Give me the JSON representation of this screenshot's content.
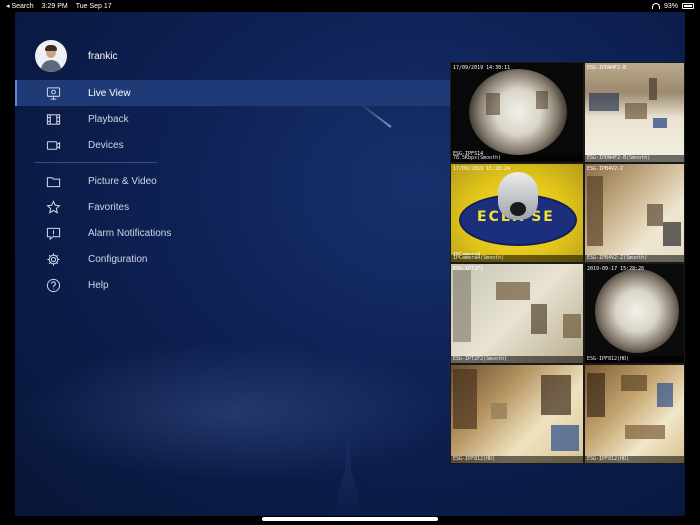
{
  "status_bar": {
    "back_label": "◂ Search",
    "time": "3:29 PM",
    "date": "Tue Sep 17",
    "battery": "93%"
  },
  "profile": {
    "username": "frankic"
  },
  "menu": {
    "items": [
      {
        "label": "Live View",
        "icon": "monitor-icon"
      },
      {
        "label": "Playback",
        "icon": "film-icon"
      },
      {
        "label": "Devices",
        "icon": "camera-icon"
      }
    ],
    "secondary_items": [
      {
        "label": "Picture & Video",
        "icon": "folder-icon"
      },
      {
        "label": "Favorites",
        "icon": "star-icon"
      },
      {
        "label": "Alarm Notifications",
        "icon": "alert-icon"
      },
      {
        "label": "Configuration",
        "icon": "gear-icon"
      },
      {
        "label": "Help",
        "icon": "help-icon"
      }
    ]
  },
  "cameras": [
    {
      "stamp": "17/09/2019 14:30:11",
      "label": "78.5Kbps(Smooth)",
      "overlay": "ESG-IPFS14"
    },
    {
      "stamp": "ESG-IPDW4F2-B",
      "label": "ESG-IPDW4F2-B(Smooth)"
    },
    {
      "stamp": "17/09/2019 15:28:24",
      "label": "IPCamera4(Smooth)",
      "overlay": "IPCamera4",
      "logo_text": "ECLIPSE"
    },
    {
      "stamp": "ESG-IPB4V2-Z",
      "label": "ESG-IPB4V2-Z(Smooth)"
    },
    {
      "stamp": "ESG-IPT2F2",
      "label": "ESG-IPT2F2(Smooth)"
    },
    {
      "stamp": "2019-09-17 15:28:26",
      "label": "ESG-IPF812(HD)"
    },
    {
      "stamp": "",
      "label": "ESG-IPF812(HD)"
    },
    {
      "stamp": "",
      "label": "ESG-IPF812(HD)"
    }
  ]
}
